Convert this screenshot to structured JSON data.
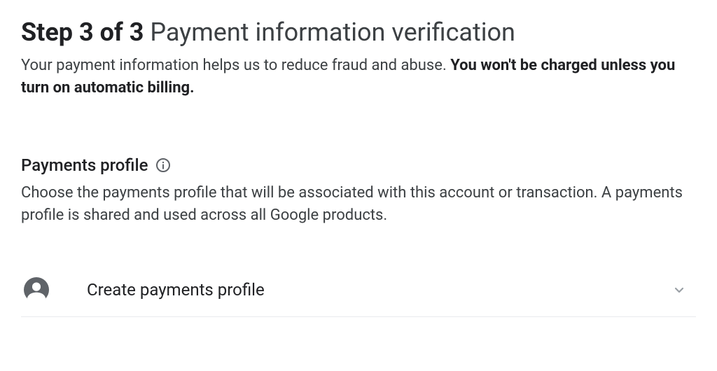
{
  "header": {
    "step_label": "Step 3 of 3",
    "title": "Payment information verification",
    "intro_text": "Your payment information helps us to reduce fraud and abuse. ",
    "intro_bold": "You won't be charged unless you turn on automatic billing."
  },
  "profile_section": {
    "title": "Payments profile",
    "description": "Choose the payments profile that will be associated with this account or transaction. A payments profile is shared and used across all Google products."
  },
  "selector": {
    "label": "Create payments profile"
  }
}
